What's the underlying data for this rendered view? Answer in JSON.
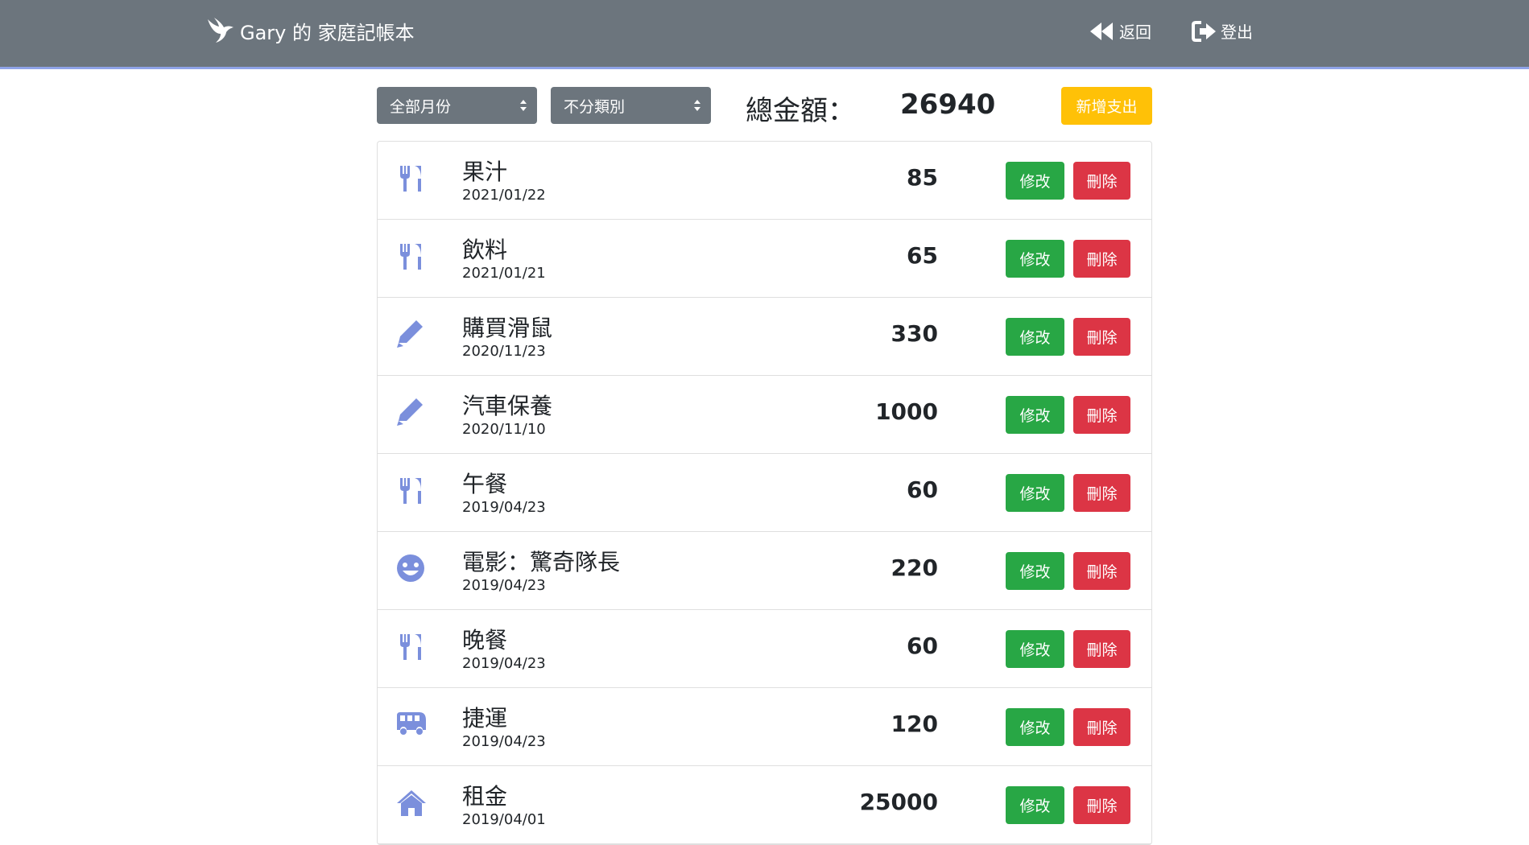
{
  "colors": {
    "navbar": "#6c757d",
    "navbar_border": "#8fa3e8",
    "icon": "#7b8fdc",
    "edit": "#28a745",
    "delete": "#dc3545",
    "add": "#ffc107"
  },
  "navbar": {
    "brand": "Gary 的 家庭記帳本",
    "back_label": "返回",
    "logout_label": "登出"
  },
  "filters": {
    "month_selected": "全部月份",
    "category_selected": "不分類別"
  },
  "total": {
    "label": "總金額：",
    "value": "26940"
  },
  "add_button": "新增支出",
  "records": [
    {
      "icon": "utensils-icon",
      "name": "果汁",
      "date": "2021/01/22",
      "amount": "85",
      "edit": "修改",
      "delete": "刪除"
    },
    {
      "icon": "utensils-icon",
      "name": "飲料",
      "date": "2021/01/21",
      "amount": "65",
      "edit": "修改",
      "delete": "刪除"
    },
    {
      "icon": "pencil-icon",
      "name": "購買滑鼠",
      "date": "2020/11/23",
      "amount": "330",
      "edit": "修改",
      "delete": "刪除"
    },
    {
      "icon": "pencil-icon",
      "name": "汽車保養",
      "date": "2020/11/10",
      "amount": "1000",
      "edit": "修改",
      "delete": "刪除"
    },
    {
      "icon": "utensils-icon",
      "name": "午餐",
      "date": "2019/04/23",
      "amount": "60",
      "edit": "修改",
      "delete": "刪除"
    },
    {
      "icon": "smile-icon",
      "name": "電影：驚奇隊長",
      "date": "2019/04/23",
      "amount": "220",
      "edit": "修改",
      "delete": "刪除"
    },
    {
      "icon": "utensils-icon",
      "name": "晚餐",
      "date": "2019/04/23",
      "amount": "60",
      "edit": "修改",
      "delete": "刪除"
    },
    {
      "icon": "bus-icon",
      "name": "捷運",
      "date": "2019/04/23",
      "amount": "120",
      "edit": "修改",
      "delete": "刪除"
    },
    {
      "icon": "home-icon",
      "name": "租金",
      "date": "2019/04/01",
      "amount": "25000",
      "edit": "修改",
      "delete": "刪除"
    }
  ]
}
